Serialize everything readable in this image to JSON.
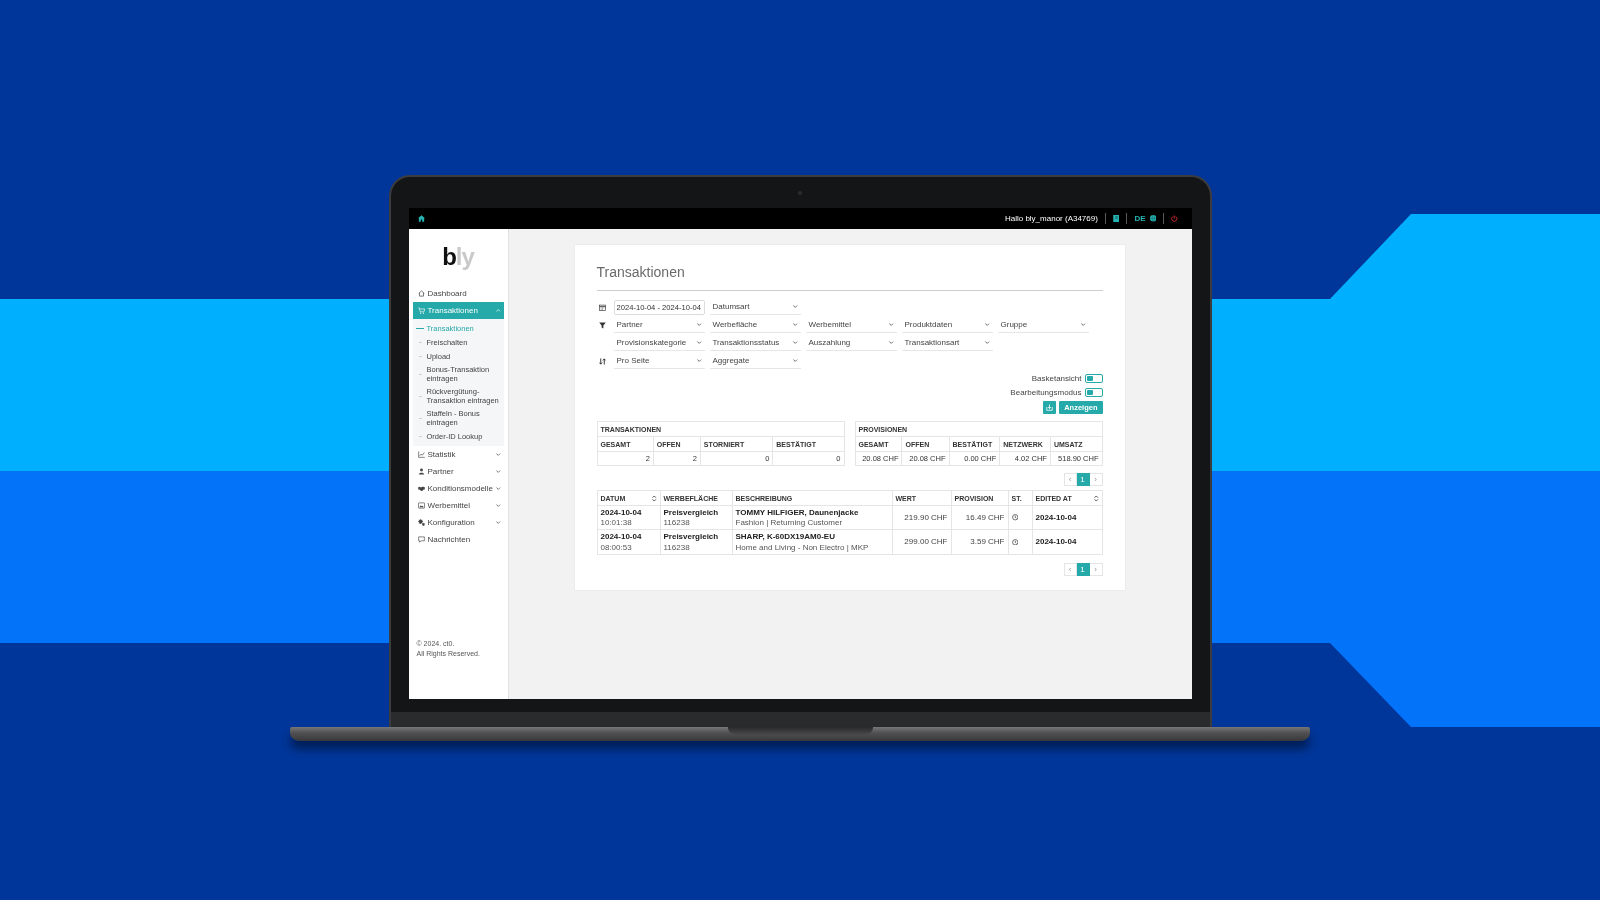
{
  "top_bar": {
    "greeting": "Hallo bly_manor (A34769)",
    "language": "DE"
  },
  "sidebar": {
    "logo": {
      "dark": "b",
      "light": "ly"
    },
    "items": [
      {
        "label": "Dashboard",
        "kind": "link",
        "selected": false
      },
      {
        "label": "Transaktionen",
        "kind": "group",
        "selected": true,
        "expanded": true,
        "children": [
          {
            "label": "Transaktionen",
            "selected": true
          },
          {
            "label": "Freischalten",
            "selected": false
          },
          {
            "label": "Upload",
            "selected": false
          },
          {
            "label": "Bonus-Transaktion eintragen",
            "selected": false
          },
          {
            "label": "Rückvergütung-Transaktion eintragen",
            "selected": false
          },
          {
            "label": "Staffeln - Bonus eintragen",
            "selected": false
          },
          {
            "label": "Order-ID Lookup",
            "selected": false
          }
        ]
      },
      {
        "label": "Statistik",
        "kind": "group",
        "selected": false,
        "expanded": false
      },
      {
        "label": "Partner",
        "kind": "group",
        "selected": false,
        "expanded": false
      },
      {
        "label": "Konditionsmodelle",
        "kind": "group",
        "selected": false,
        "expanded": false
      },
      {
        "label": "Werbemittel",
        "kind": "group",
        "selected": false,
        "expanded": false
      },
      {
        "label": "Konfiguration",
        "kind": "group",
        "selected": false,
        "expanded": false
      },
      {
        "label": "Nachrichten",
        "kind": "link",
        "selected": false
      }
    ],
    "footer": [
      "© 2024. ct0.",
      "All Rights Reserved."
    ]
  },
  "page": {
    "title": "Transaktionen"
  },
  "filters": [
    {
      "fields": [
        {
          "kind": "date",
          "value": "2024-10-04 - 2024-10-04"
        },
        {
          "kind": "select",
          "placeholder": "Datumsart"
        }
      ]
    },
    {
      "fields": [
        {
          "kind": "select",
          "placeholder": "Partner"
        },
        {
          "kind": "select",
          "placeholder": "Werbefläche"
        },
        {
          "kind": "select",
          "placeholder": "Werbemittel"
        },
        {
          "kind": "select",
          "placeholder": "Produktdaten"
        },
        {
          "kind": "select",
          "placeholder": "Gruppe"
        }
      ]
    },
    {
      "fields": [
        {
          "kind": "select",
          "placeholder": "Provisionskategorie"
        },
        {
          "kind": "select",
          "placeholder": "Transaktionsstatus"
        },
        {
          "kind": "select",
          "placeholder": "Auszahlung"
        },
        {
          "kind": "select",
          "placeholder": "Transaktionsart"
        }
      ]
    },
    {
      "fields": [
        {
          "kind": "select",
          "placeholder": "Pro Seite"
        },
        {
          "kind": "select",
          "placeholder": "Aggregate"
        }
      ]
    }
  ],
  "switches": [
    {
      "label": "Basketansicht",
      "on": false
    },
    {
      "label": "Bearbeitungsmodus",
      "on": false
    }
  ],
  "show_button": "Anzeigen",
  "summaries": [
    {
      "title": "TRANSAKTIONEN",
      "columns": [
        "GESAMT",
        "OFFEN",
        "STORNIERT",
        "BESTÄTIGT"
      ],
      "values": [
        "2",
        "2",
        "0",
        "0"
      ]
    },
    {
      "title": "PROVISIONEN",
      "columns": [
        "GESAMT",
        "OFFEN",
        "BESTÄTIGT",
        "NETZWERK",
        "UMSATZ"
      ],
      "values": [
        "20.08 CHF",
        "20.08 CHF",
        "0.00 CHF",
        "4.02 CHF",
        "518.90 CHF"
      ]
    }
  ],
  "pagination": [
    {
      "prev": "‹",
      "next": "›",
      "pages": [
        {
          "label": "1",
          "selected": true
        }
      ]
    },
    {
      "prev": "‹",
      "next": "›",
      "pages": [
        {
          "label": "1",
          "selected": true
        }
      ]
    }
  ],
  "table": {
    "columns": [
      {
        "label": "DATUM",
        "sortable": true
      },
      {
        "label": "WERBEFLÄCHE",
        "sortable": false
      },
      {
        "label": "BESCHREIBUNG",
        "sortable": false
      },
      {
        "label": "WERT",
        "sortable": false
      },
      {
        "label": "PROVISION",
        "sortable": false
      },
      {
        "label": "ST.",
        "sortable": false
      },
      {
        "label": "EDITED AT",
        "sortable": true
      }
    ],
    "rows": [
      {
        "datum": {
          "date": "2024-10-04",
          "time": "10:01:38"
        },
        "werbeflaeche": {
          "name": "Preisvergleich",
          "id": "116238"
        },
        "beschreibung": {
          "title": "TOMMY HILFIGER, Daunenjacke",
          "category": "Fashion | Returning Customer"
        },
        "wert": "219.90 CHF",
        "provision": "16.49 CHF",
        "pending": true,
        "edited_at": "2024-10-04"
      },
      {
        "datum": {
          "date": "2024-10-04",
          "time": "08:00:53"
        },
        "werbeflaeche": {
          "name": "Preisvergleich",
          "id": "116238"
        },
        "beschreibung": {
          "title": "SHARP, K-60DX19AM0-EU",
          "category": "Home and Living - Non Electro | MKP"
        },
        "wert": "299.00 CHF",
        "provision": "3.59 CHF",
        "pending": true,
        "edited_at": "2024-10-04"
      }
    ]
  }
}
